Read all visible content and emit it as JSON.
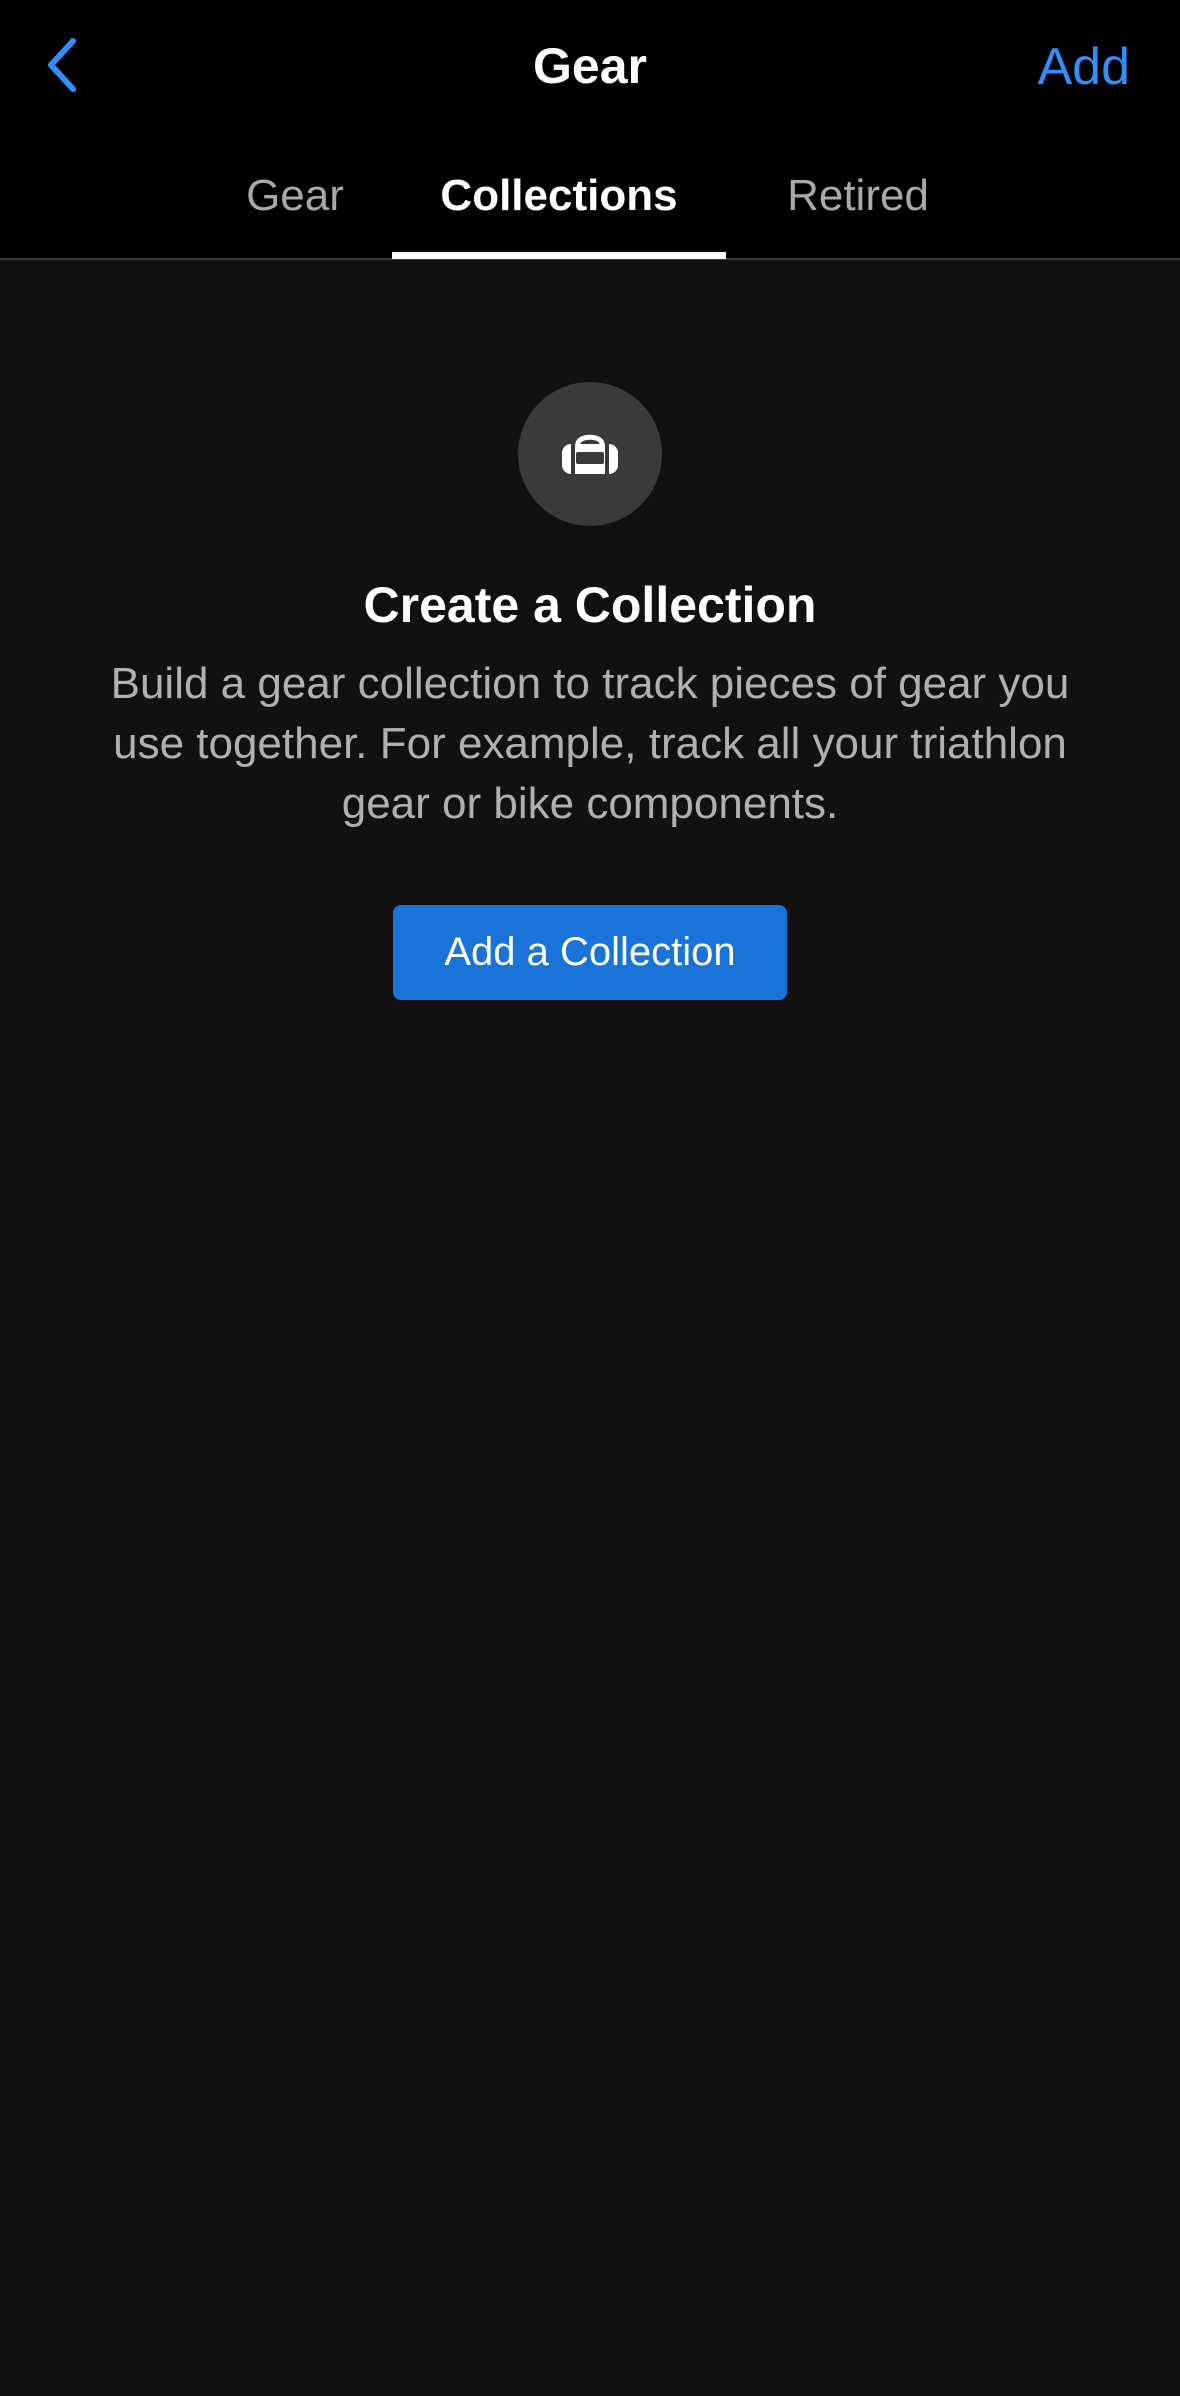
{
  "nav": {
    "title": "Gear",
    "add_label": "Add"
  },
  "tabs": [
    {
      "label": "Gear",
      "selected": false
    },
    {
      "label": "Collections",
      "selected": true
    },
    {
      "label": "Retired",
      "selected": false
    }
  ],
  "empty_state": {
    "icon": "duffel-bag-icon",
    "title": "Create a Collection",
    "description": "Build a gear collection to track pieces of gear you use together. For example, track all your triathlon gear or bike components.",
    "button_label": "Add a Collection"
  },
  "colors": {
    "accent": "#2f8fff",
    "button": "#1a73d8",
    "background": "#111111",
    "header": "#000000"
  }
}
